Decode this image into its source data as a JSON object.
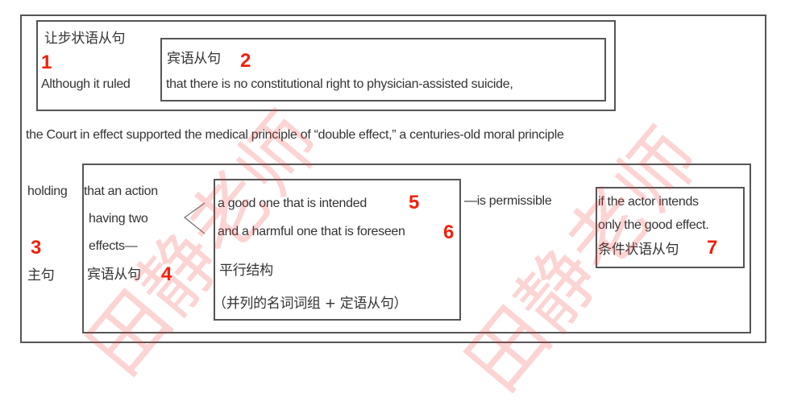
{
  "concession": {
    "label": "让步状语从句",
    "number": "1",
    "text": "Although it ruled"
  },
  "object_clause_1": {
    "label": "宾语从句",
    "number": "2",
    "text": "that there is no constitutional right to physician-assisted suicide,"
  },
  "main_line": "the Court in effect supported the medical principle of “double effect,” a centuries-old moral principle",
  "main_clause": {
    "number": "3",
    "label": "主句",
    "word": "holding"
  },
  "object_clause_2": {
    "line1": "that an action",
    "line2": "having two",
    "line3": "effects—",
    "label": "宾语从句",
    "number": "4"
  },
  "parallel": {
    "item1": "a good one that is intended",
    "number1": "5",
    "item2": "and a harmful one that is foreseen",
    "number2": "6",
    "label": "平行结构",
    "note": "（并列的名词词组 + 定语从句）"
  },
  "predicate": "—is permissible",
  "condition": {
    "line1": "if the actor intends",
    "line2": "only the good effect.",
    "label": "条件状语从句",
    "number": "7"
  },
  "watermark": "田静老师",
  "colors": {
    "number": "#f0210d",
    "border": "#555555",
    "watermark": "#f03c3c"
  }
}
